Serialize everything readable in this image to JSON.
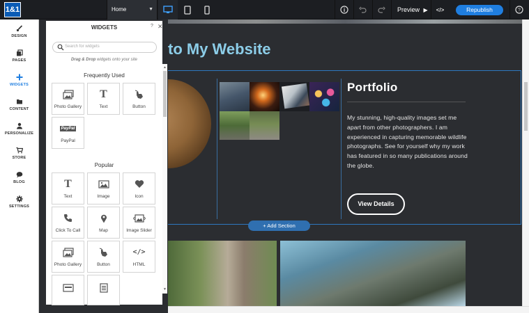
{
  "topbar": {
    "logo_text": "1&1",
    "page_select_value": "Home",
    "devices": [
      "desktop-icon",
      "tablet-icon",
      "mobile-icon"
    ],
    "preview_label": "Preview",
    "republish_label": "Republish"
  },
  "rail": {
    "items": [
      {
        "label": "DESIGN",
        "icon": "brush-icon"
      },
      {
        "label": "PAGES",
        "icon": "pages-icon"
      },
      {
        "label": "WIDGETS",
        "icon": "plus-icon"
      },
      {
        "label": "CONTENT",
        "icon": "folder-icon"
      },
      {
        "label": "PERSONALIZE",
        "icon": "person-icon"
      },
      {
        "label": "STORE",
        "icon": "cart-icon"
      },
      {
        "label": "BLOG",
        "icon": "chat-icon"
      },
      {
        "label": "SETTINGS",
        "icon": "gear-icon"
      }
    ]
  },
  "panel": {
    "title": "WIDGETS",
    "help": "?",
    "search_placeholder": "Search for widgets",
    "hint_bold": "Drag & Drop",
    "hint_rest": " widgets onto your site",
    "frequently_used_label": "Frequently Used",
    "frequently_used": [
      {
        "label": "Photo Gallery",
        "icon": "photo-gallery-icon"
      },
      {
        "label": "Text",
        "icon": "text-icon"
      },
      {
        "label": "Button",
        "icon": "button-icon"
      },
      {
        "label": "PayPal",
        "icon": "paypal-icon"
      }
    ],
    "popular_label": "Popular",
    "popular": [
      {
        "label": "Text",
        "icon": "text-icon"
      },
      {
        "label": "Image",
        "icon": "image-icon"
      },
      {
        "label": "Icon",
        "icon": "heart-icon"
      },
      {
        "label": "Click To Call",
        "icon": "phone-icon"
      },
      {
        "label": "Map",
        "icon": "map-pin-icon"
      },
      {
        "label": "Image Slider",
        "icon": "image-slider-icon"
      },
      {
        "label": "Photo Gallery",
        "icon": "photo-gallery-icon"
      },
      {
        "label": "Button",
        "icon": "button-icon"
      },
      {
        "label": "HTML",
        "icon": "code-icon"
      },
      {
        "label": "",
        "icon": "form-icon"
      },
      {
        "label": "",
        "icon": "document-icon"
      }
    ]
  },
  "site": {
    "title": "to My Website",
    "portfolio_heading": "Portfolio",
    "portfolio_text": "My stunning, high-quality images set me apart from other photographers. I am experienced in capturing memorable wildlife photographs. See for yourself why my work has featured in so many publications around the globe.",
    "view_details_label": "View Details",
    "add_section_label": "+ Add Section"
  },
  "colors": {
    "accent": "#1f7ee0",
    "title_blue": "#8ccde8",
    "canvas_bg": "#2b2d31",
    "section_border": "#2e78c0"
  }
}
